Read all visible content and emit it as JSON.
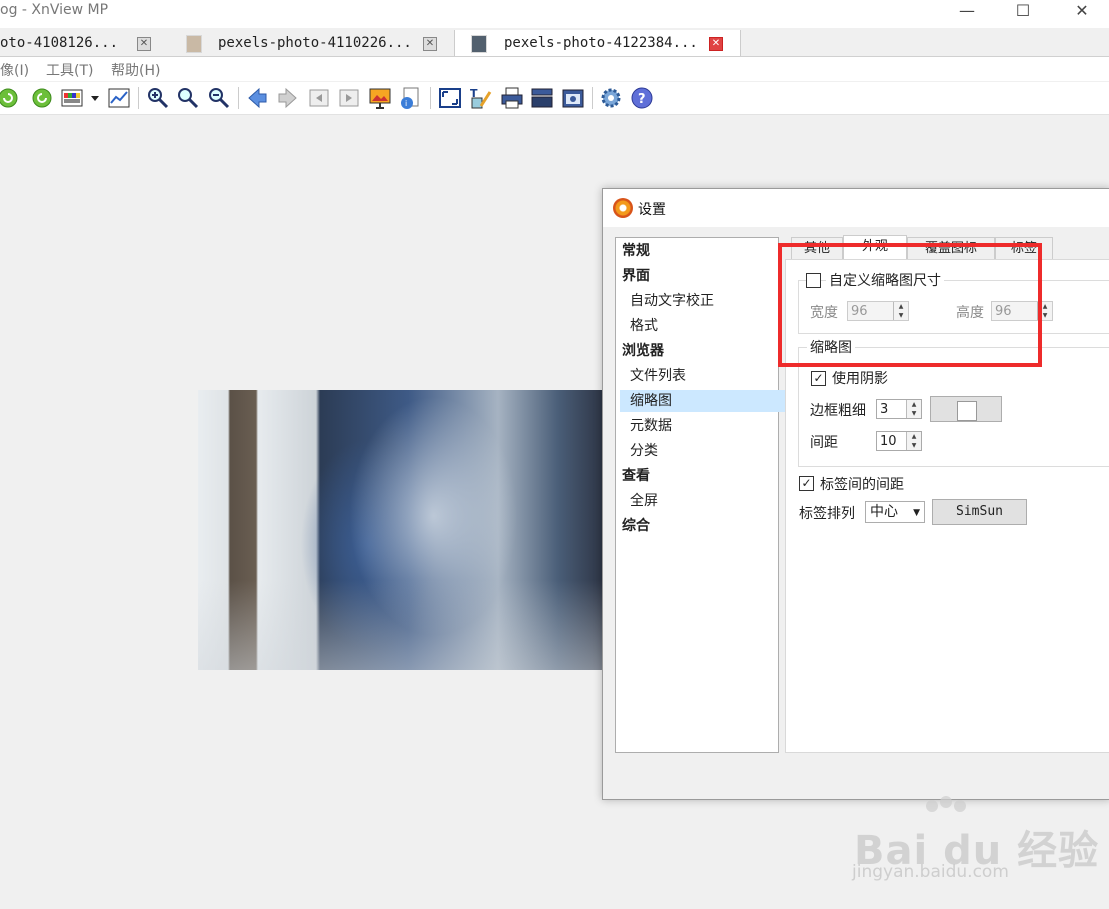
{
  "window": {
    "title": "og - XnView MP",
    "minimize": "—",
    "maximize": "☐",
    "close": "✕"
  },
  "tabs": [
    {
      "label": "oto-4108126...",
      "close": "✕",
      "active": false
    },
    {
      "label": "pexels-photo-4110226...",
      "close": "✕",
      "active": false
    },
    {
      "label": "pexels-photo-4122384...",
      "close": "✕",
      "active": true
    }
  ],
  "menu": [
    {
      "label": "像(I)"
    },
    {
      "label": "工具(T)"
    },
    {
      "label": "帮助(H)"
    }
  ],
  "toolbar_icons": [
    "rotate-left-icon",
    "rotate-right-icon",
    "color-adjust-icon",
    "dropdown-arrow-icon",
    "levels-icon",
    "zoom-in-icon",
    "zoom-fit-icon",
    "zoom-out-icon",
    "previous-icon",
    "next-icon",
    "first-page-icon",
    "last-page-icon",
    "slideshow-icon",
    "properties-icon",
    "fullscreen-icon",
    "edit-text-icon",
    "print-icon",
    "scan-icon",
    "capture-icon",
    "settings-icon",
    "help-icon"
  ],
  "dialog": {
    "title": "设置",
    "nav": [
      {
        "label": "常规",
        "kind": "cat"
      },
      {
        "label": "界面",
        "kind": "cat"
      },
      {
        "label": "自动文字校正",
        "kind": "sub"
      },
      {
        "label": "格式",
        "kind": "sub"
      },
      {
        "label": "浏览器",
        "kind": "cat"
      },
      {
        "label": "文件列表",
        "kind": "sub"
      },
      {
        "label": "缩略图",
        "kind": "sub",
        "selected": true
      },
      {
        "label": "元数据",
        "kind": "sub"
      },
      {
        "label": "分类",
        "kind": "sub"
      },
      {
        "label": "查看",
        "kind": "cat"
      },
      {
        "label": "全屏",
        "kind": "sub"
      },
      {
        "label": "综合",
        "kind": "cat"
      }
    ],
    "panel_tabs": [
      {
        "label": "其他"
      },
      {
        "label": "外观",
        "active": true
      },
      {
        "label": "覆盖图标"
      },
      {
        "label": "标签"
      }
    ],
    "custom_size": {
      "label": "自定义缩略图尺寸",
      "checked": false,
      "width_label": "宽度",
      "width_value": "96",
      "height_label": "高度",
      "height_value": "96"
    },
    "thumbnail": {
      "group_label": "缩略图",
      "shadow_label": "使用阴影",
      "shadow_checked": true,
      "border_label": "边框粗细",
      "border_value": "3",
      "spacing_label": "间距",
      "spacing_value": "10"
    },
    "label_spacing": {
      "label": "标签间的间距",
      "checked": true
    },
    "label_align": {
      "label": "标签排列",
      "value": "中心",
      "font_button": "SimSun"
    }
  },
  "watermark": {
    "brand": "Bai  du 经验",
    "url": "jingyan.baidu.com"
  },
  "colors": {
    "highlight": "#ee2b2b",
    "selection": "#cce8ff"
  }
}
